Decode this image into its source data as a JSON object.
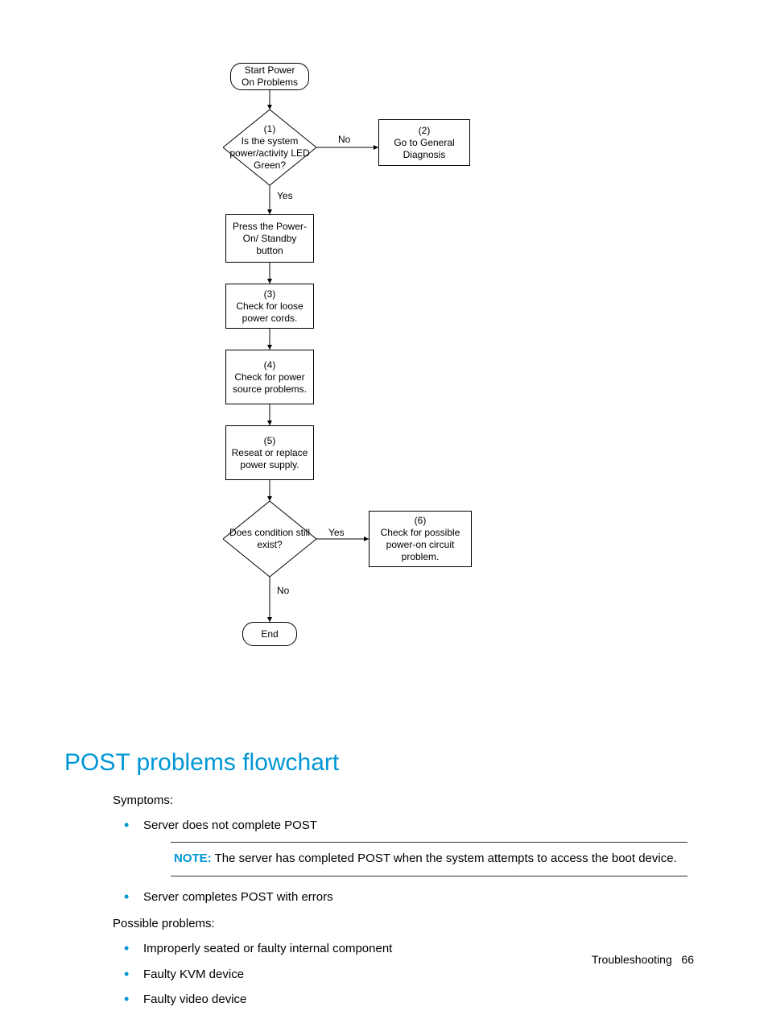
{
  "flow": {
    "start": "Start Power On Problems",
    "d1": "(1)\nIs the system power/activity LED Green?",
    "d1_no": "No",
    "d1_yes": "Yes",
    "p2": "(2)\nGo to General Diagnosis",
    "p_press": "Press the Power-On/ Standby button",
    "p3": "(3)\nCheck for loose power cords.",
    "p4": "(4)\nCheck for power source problems.",
    "p5": "(5)\nReseat or replace power supply.",
    "d2": "Does condition still exist?",
    "d2_yes": "Yes",
    "d2_no": "No",
    "p6": "(6)\nCheck for possible power-on circuit problem.",
    "end": "End"
  },
  "heading": "POST problems flowchart",
  "symptoms_label": "Symptoms:",
  "symptom1": "Server does not complete POST",
  "symptom2": "Server completes POST with errors",
  "note_label": "NOTE:",
  "note_text": "  The server has completed POST when the system attempts to access the boot device.",
  "possible_label": "Possible problems:",
  "possible1": "Improperly seated or faulty internal component",
  "possible2": "Faulty KVM device",
  "possible3": "Faulty video device",
  "footer_section": "Troubleshooting",
  "footer_page": "66"
}
